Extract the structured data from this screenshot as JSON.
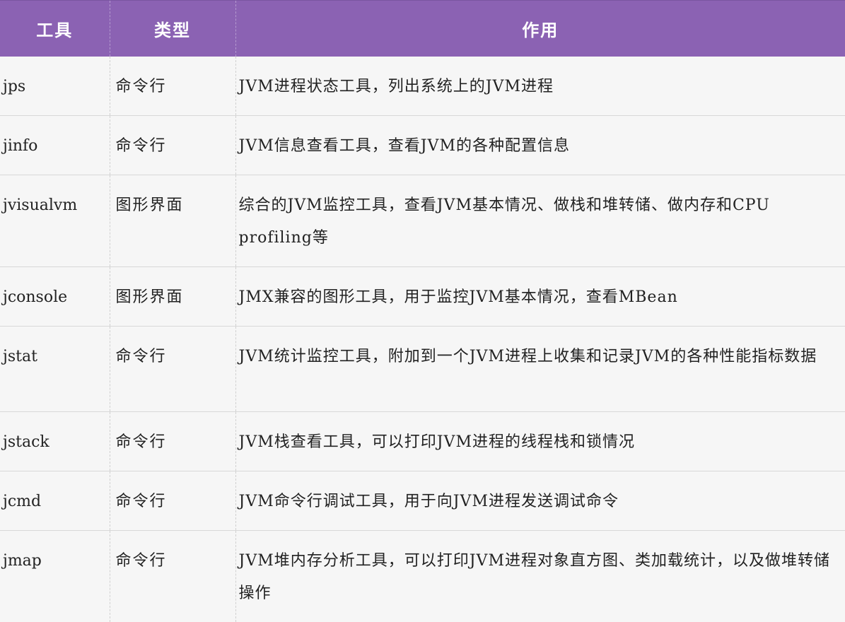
{
  "header": {
    "col_tool": "工具",
    "col_type": "类型",
    "col_purpose": "作用"
  },
  "rows": [
    {
      "tool": "jps",
      "type": "命令行",
      "purpose": "JVM进程状态工具，列出系统上的JVM进程"
    },
    {
      "tool": "jinfo",
      "type": "命令行",
      "purpose": "JVM信息查看工具，查看JVM的各种配置信息"
    },
    {
      "tool": "jvisualvm",
      "type": "图形界面",
      "purpose": "综合的JVM监控工具，查看JVM基本情况、做栈和堆转储、做内存和CPU profiling等"
    },
    {
      "tool": "jconsole",
      "type": "图形界面",
      "purpose": "JMX兼容的图形工具，用于监控JVM基本情况，查看MBean"
    },
    {
      "tool": "jstat",
      "type": "命令行",
      "purpose": "JVM统计监控工具，附加到一个JVM进程上收集和记录JVM的各种性能指标数据"
    },
    {
      "tool": "jstack",
      "type": "命令行",
      "purpose": "JVM栈查看工具，可以打印JVM进程的线程栈和锁情况"
    },
    {
      "tool": "jcmd",
      "type": "命令行",
      "purpose": "JVM命令行调试工具，用于向JVM进程发送调试命令"
    },
    {
      "tool": "jmap",
      "type": "命令行",
      "purpose": "JVM堆内存分析工具，可以打印JVM进程对象直方图、类加载统计，以及做堆转储操作"
    }
  ],
  "colors": {
    "header_bg": "#8b62b3",
    "header_text": "#ffffff",
    "body_bg": "#f6f6f6"
  }
}
